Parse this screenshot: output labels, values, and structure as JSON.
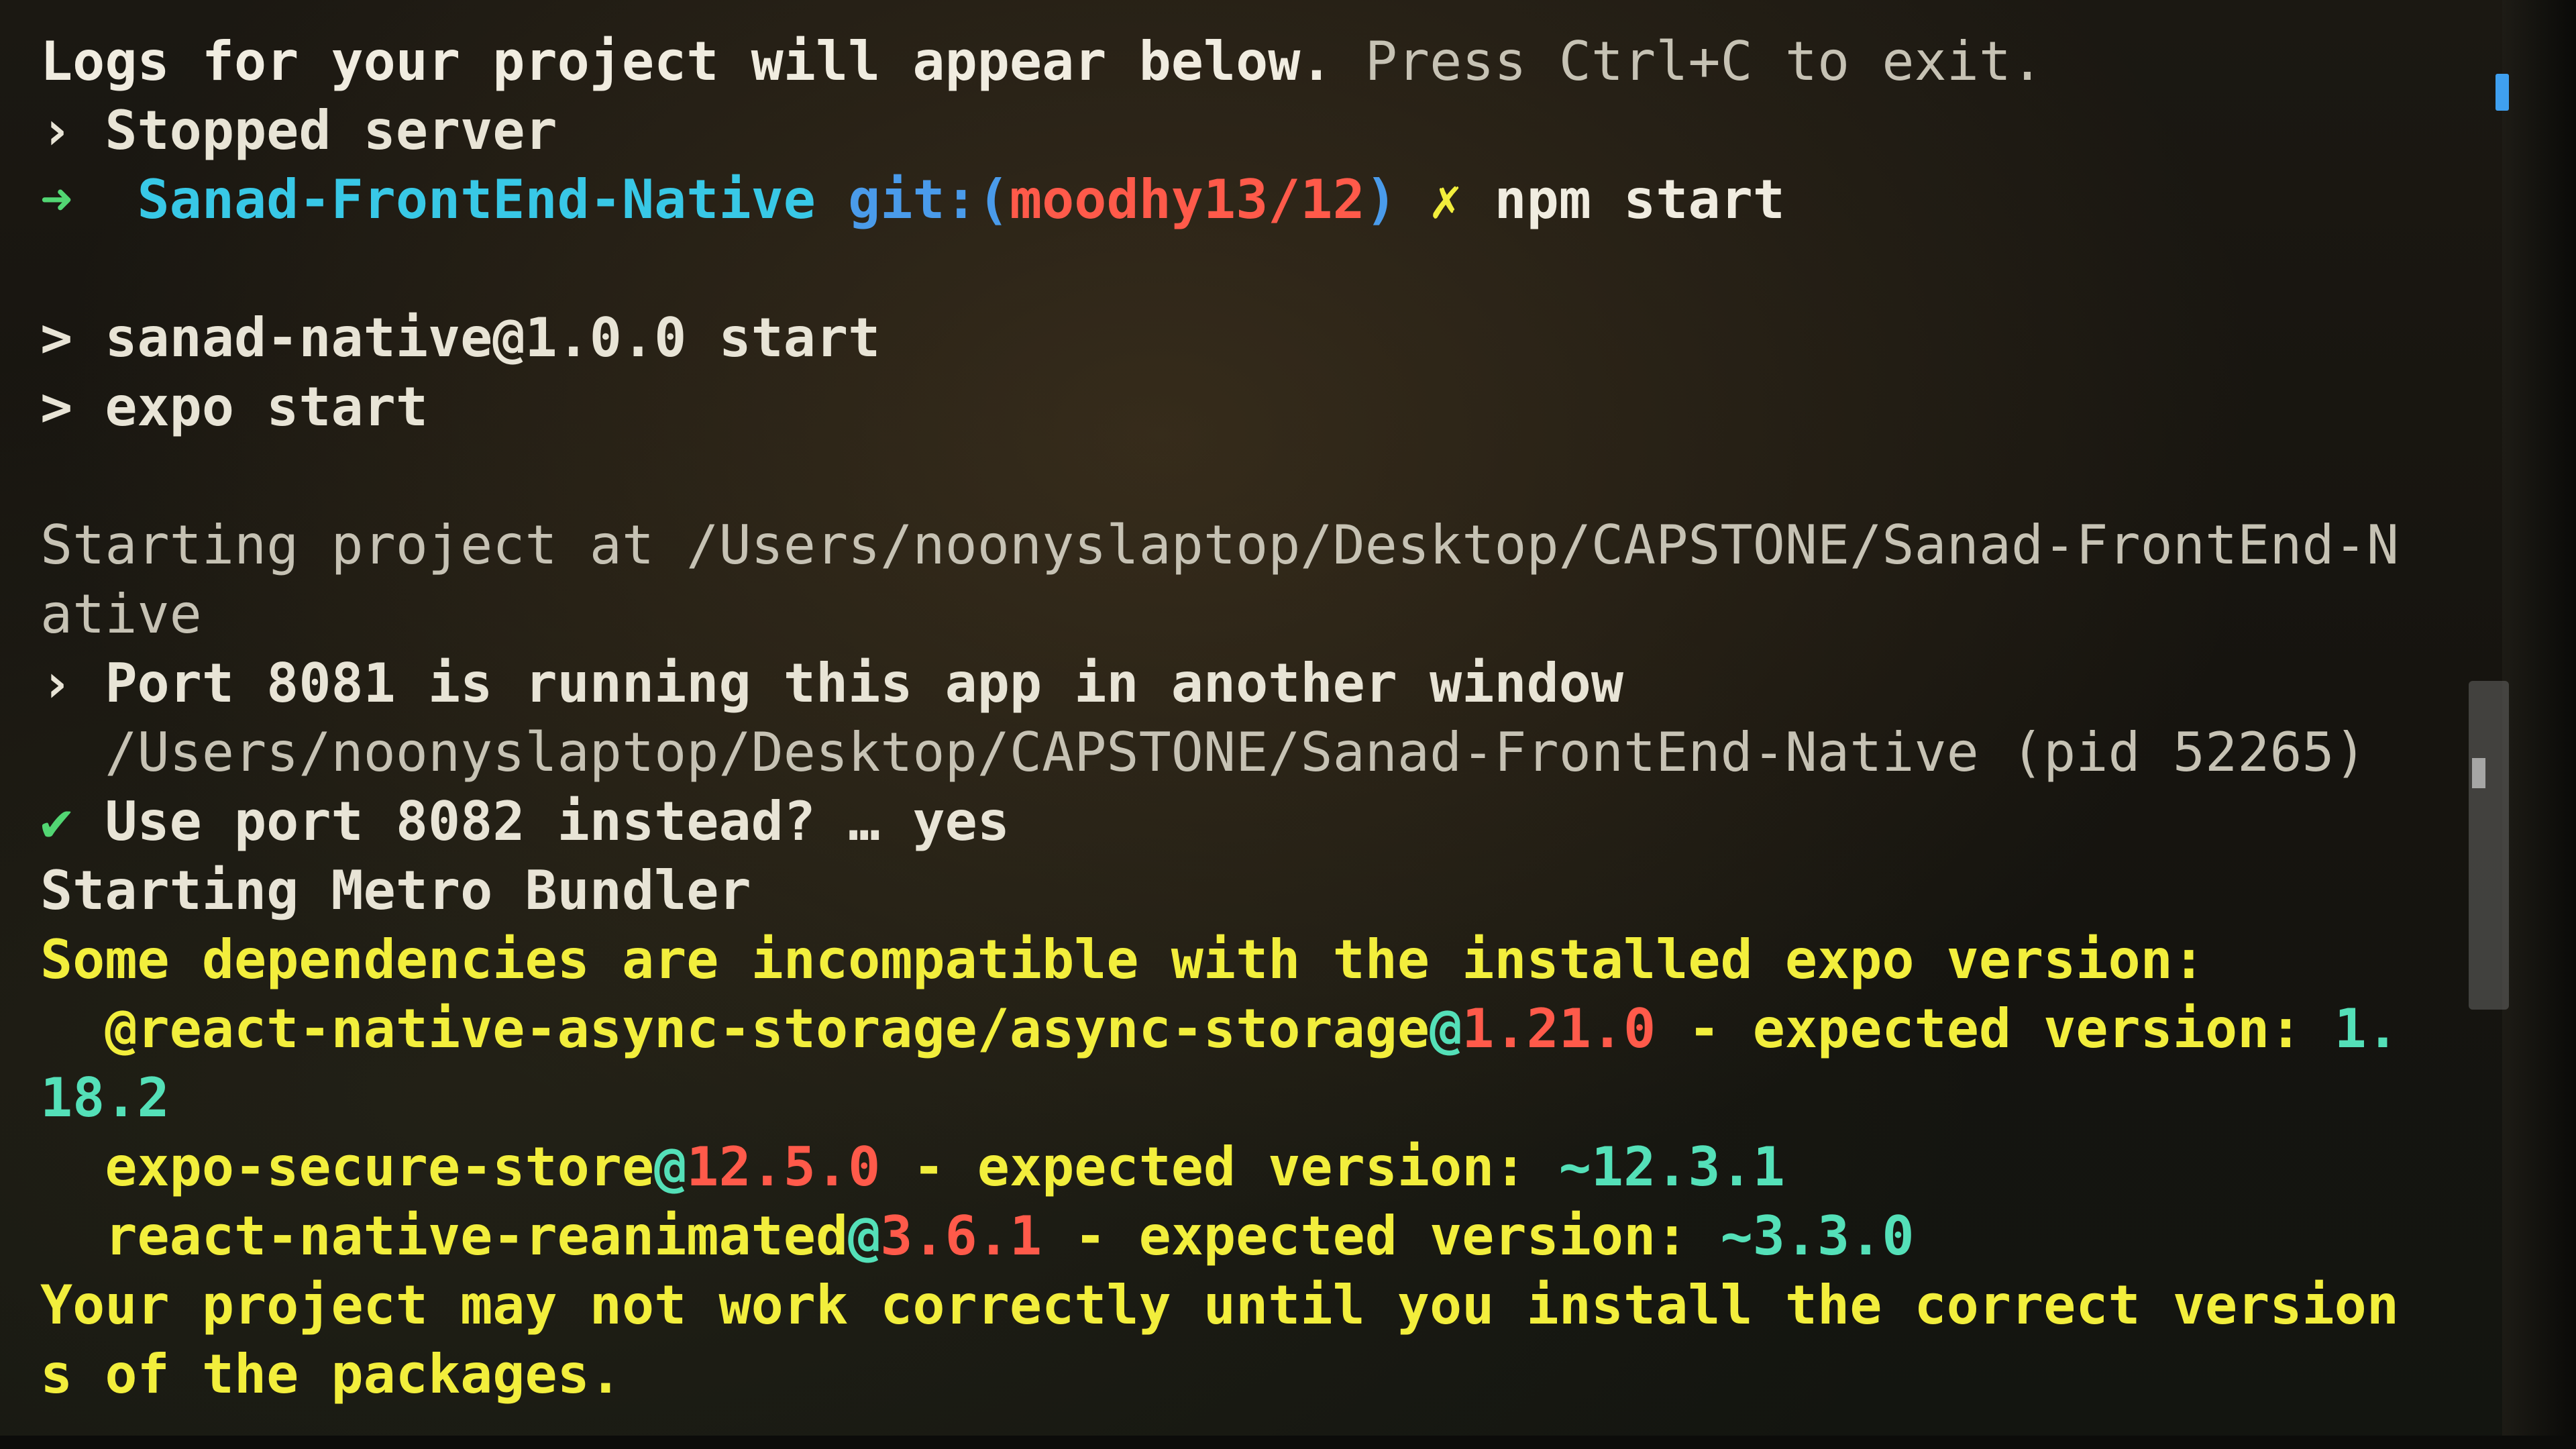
{
  "glyphs": {
    "chevron": "›",
    "prompt_arrow": "➜",
    "dirty": "✗",
    "gt": ">",
    "check": "✔",
    "at": "@"
  },
  "prompt": {
    "directory": "Sanad-FrontEnd-Native",
    "git_label": "git:(",
    "branch": "moodhy13/12",
    "git_close": ")",
    "command": "npm start"
  },
  "lines": {
    "intro_a": "Logs for your project will appear below. ",
    "intro_b": "Press Ctrl+C to exit.",
    "stopped": "Stopped server",
    "npm_pkg": "sanad-native@1.0.0 start",
    "npm_cmd": "expo start",
    "starting_project_1": "Starting project at /Users/noonyslaptop/Desktop/CAPSTONE/Sanad-FrontEnd-N",
    "starting_project_2": "ative",
    "port_running": "Port 8081 is running this app in another window",
    "port_path": "  /Users/noonyslaptop/Desktop/CAPSTONE/Sanad-FrontEnd-Native (pid 52265)",
    "use_port": "Use port 8082 instead? … yes",
    "metro": "Starting Metro Bundler",
    "incompat": "Some dependencies are incompatible with the installed expo version:",
    "closing_1": "Your project may not work correctly until you install the correct version",
    "closing_2": "s of the packages."
  },
  "deps": [
    {
      "name": "@react-native-async-storage/async-storage",
      "installed": "1.21.0",
      "sep": " - expected version: ",
      "expected_a": "1.",
      "expected_b": "18.2"
    },
    {
      "name": "expo-secure-store",
      "installed": "12.5.0",
      "sep": " - expected version: ",
      "expected": "~12.3.1"
    },
    {
      "name": "react-native-reanimated",
      "installed": "3.6.1",
      "sep": " - expected version: ",
      "expected": "~3.3.0"
    }
  ],
  "colors": {
    "prompt_directory": "#38c8e6",
    "git_label": "#4a9bea",
    "branch": "#ff5a4a",
    "warning": "#f2ee3c",
    "expected_version": "#54e0b8",
    "installed_version": "#ff5a4a",
    "success": "#52d673"
  }
}
